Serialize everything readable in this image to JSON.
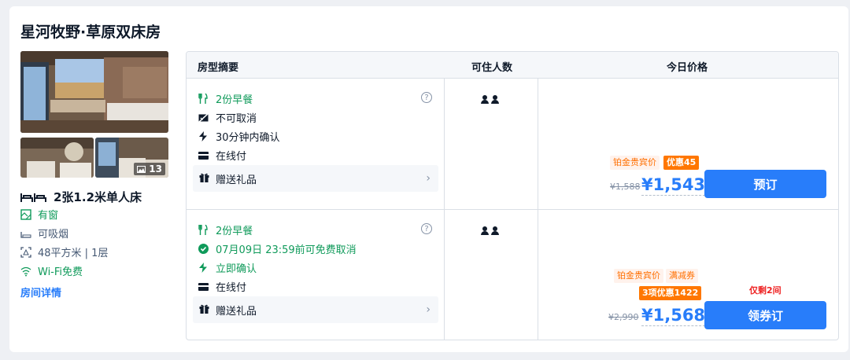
{
  "room": {
    "title": "星河牧野·草原双床房",
    "photo_count": "13",
    "bed": "2张1.2米单人床",
    "facilities": [
      {
        "label": "有窗",
        "icon": "window-icon"
      },
      {
        "label": "可吸烟",
        "icon": "smoking-icon"
      },
      {
        "label": "48平方米 | 1层",
        "icon": "area-icon"
      },
      {
        "label": "Wi-Fi免费",
        "icon": "wifi-icon"
      }
    ],
    "detail_link": "房间详情"
  },
  "table": {
    "headers": [
      "房型摘要",
      "可住人数",
      "今日价格"
    ],
    "offers": [
      {
        "policies": [
          "2份早餐",
          "不可取消",
          "30分钟内确认",
          "在线付"
        ],
        "gift": "赠送礼品",
        "tags": [
          "铂金贵宾价",
          "优惠45"
        ],
        "old_price": "¥1,588",
        "price": "¥1,543",
        "button": "预订"
      },
      {
        "policies": [
          "2份早餐",
          "07月09日 23:59前可免费取消",
          "立即确认",
          "在线付"
        ],
        "gift": "赠送礼品",
        "tags": [
          "铂金贵宾价",
          "满减券",
          "3项优惠1422"
        ],
        "scarcity": "仅剩2间",
        "old_price": "¥2,990",
        "price": "¥1,568",
        "button": "领券订"
      }
    ]
  },
  "colors": {
    "accent": "#287dfa",
    "green": "#0f9a5a",
    "orange": "#ff7700"
  }
}
